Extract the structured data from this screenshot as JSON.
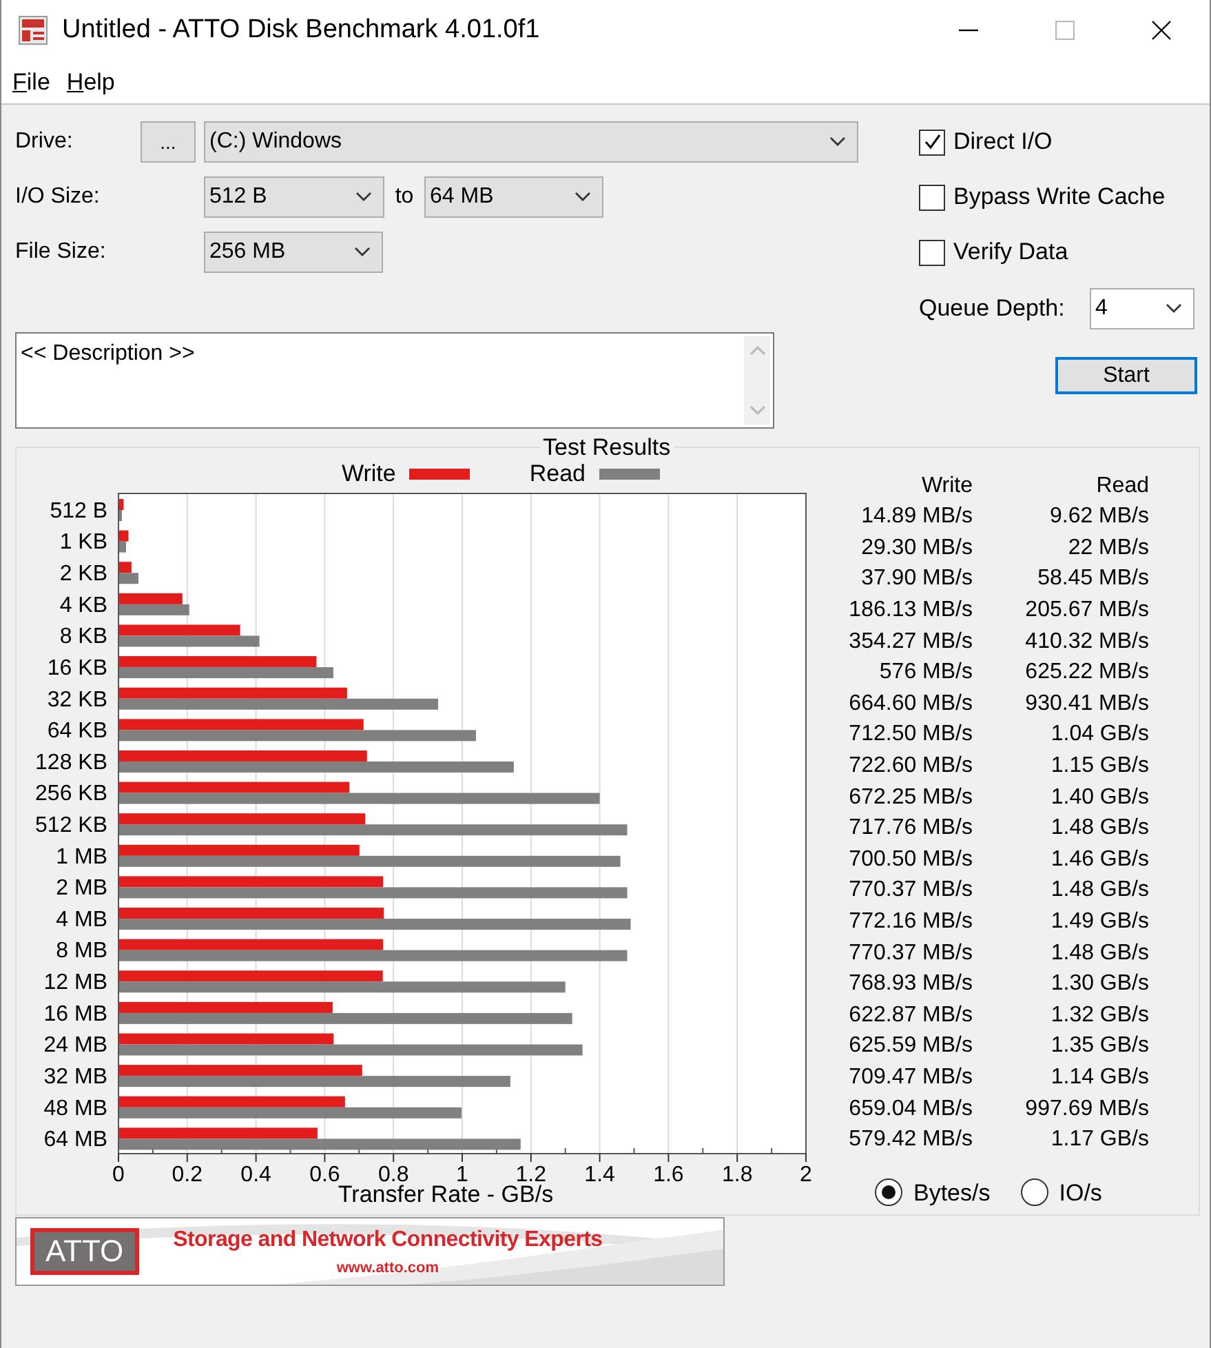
{
  "window": {
    "title": "Untitled - ATTO Disk Benchmark 4.01.0f1"
  },
  "menu": [
    "File",
    "Help"
  ],
  "drive": {
    "label": "Drive:",
    "browse_button": "...",
    "value": "(C:) Windows"
  },
  "io_size": {
    "label": "I/O Size:",
    "from": "512 B",
    "to_label": "to",
    "to": "64 MB"
  },
  "file_size": {
    "label": "File Size:",
    "value": "256 MB"
  },
  "options": [
    {
      "label": "Direct I/O",
      "checked": true
    },
    {
      "label": "Bypass Write Cache",
      "checked": false
    },
    {
      "label": "Verify Data",
      "checked": false
    }
  ],
  "queue_depth": {
    "label": "Queue Depth:",
    "value": "4"
  },
  "start_button": "Start",
  "description": {
    "value": "<< Description >>"
  },
  "test_results": {
    "title": "Test Results",
    "chart_data": {
      "type": "bar",
      "orientation": "horizontal",
      "xlabel": "Transfer Rate - GB/s",
      "categories": [
        "512 B",
        "1 KB",
        "2 KB",
        "4 KB",
        "8 KB",
        "16 KB",
        "32 KB",
        "64 KB",
        "128 KB",
        "256 KB",
        "512 KB",
        "1 MB",
        "2 MB",
        "4 MB",
        "8 MB",
        "12 MB",
        "16 MB",
        "24 MB",
        "32 MB",
        "48 MB",
        "64 MB"
      ],
      "series": [
        {
          "name": "Write",
          "color": "#e31c1c",
          "values": [
            0.015,
            0.029,
            0.038,
            0.186,
            0.354,
            0.576,
            0.665,
            0.713,
            0.723,
            0.672,
            0.718,
            0.701,
            0.77,
            0.772,
            0.77,
            0.769,
            0.623,
            0.626,
            0.709,
            0.659,
            0.579
          ]
        },
        {
          "name": "Read",
          "color": "#808080",
          "values": [
            0.01,
            0.022,
            0.058,
            0.206,
            0.41,
            0.625,
            0.93,
            1.04,
            1.15,
            1.4,
            1.48,
            1.46,
            1.48,
            1.49,
            1.48,
            1.3,
            1.32,
            1.35,
            1.14,
            0.998,
            1.17
          ]
        }
      ],
      "grid": true,
      "xlim": [
        0,
        2
      ],
      "xticks": [
        0,
        0.2,
        0.4,
        0.6,
        0.8,
        1,
        1.2,
        1.4,
        1.6,
        1.8,
        2
      ]
    },
    "table": {
      "columns": [
        "Write",
        "Read"
      ],
      "rows": [
        [
          "14.89 MB/s",
          "9.62 MB/s"
        ],
        [
          "29.30 MB/s",
          "22 MB/s"
        ],
        [
          "37.90 MB/s",
          "58.45 MB/s"
        ],
        [
          "186.13 MB/s",
          "205.67 MB/s"
        ],
        [
          "354.27 MB/s",
          "410.32 MB/s"
        ],
        [
          "576 MB/s",
          "625.22 MB/s"
        ],
        [
          "664.60 MB/s",
          "930.41 MB/s"
        ],
        [
          "712.50 MB/s",
          "1.04 GB/s"
        ],
        [
          "722.60 MB/s",
          "1.15 GB/s"
        ],
        [
          "672.25 MB/s",
          "1.40 GB/s"
        ],
        [
          "717.76 MB/s",
          "1.48 GB/s"
        ],
        [
          "700.50 MB/s",
          "1.46 GB/s"
        ],
        [
          "770.37 MB/s",
          "1.48 GB/s"
        ],
        [
          "772.16 MB/s",
          "1.49 GB/s"
        ],
        [
          "770.37 MB/s",
          "1.48 GB/s"
        ],
        [
          "768.93 MB/s",
          "1.30 GB/s"
        ],
        [
          "622.87 MB/s",
          "1.32 GB/s"
        ],
        [
          "625.59 MB/s",
          "1.35 GB/s"
        ],
        [
          "709.47 MB/s",
          "1.14 GB/s"
        ],
        [
          "659.04 MB/s",
          "997.69 MB/s"
        ],
        [
          "579.42 MB/s",
          "1.17 GB/s"
        ]
      ]
    },
    "units": [
      {
        "label": "Bytes/s",
        "selected": true
      },
      {
        "label": "IO/s",
        "selected": false
      }
    ]
  },
  "banner": {
    "logo": "ATTO",
    "tagline": "Storage and Network Connectivity Experts",
    "url": "www.atto.com"
  }
}
